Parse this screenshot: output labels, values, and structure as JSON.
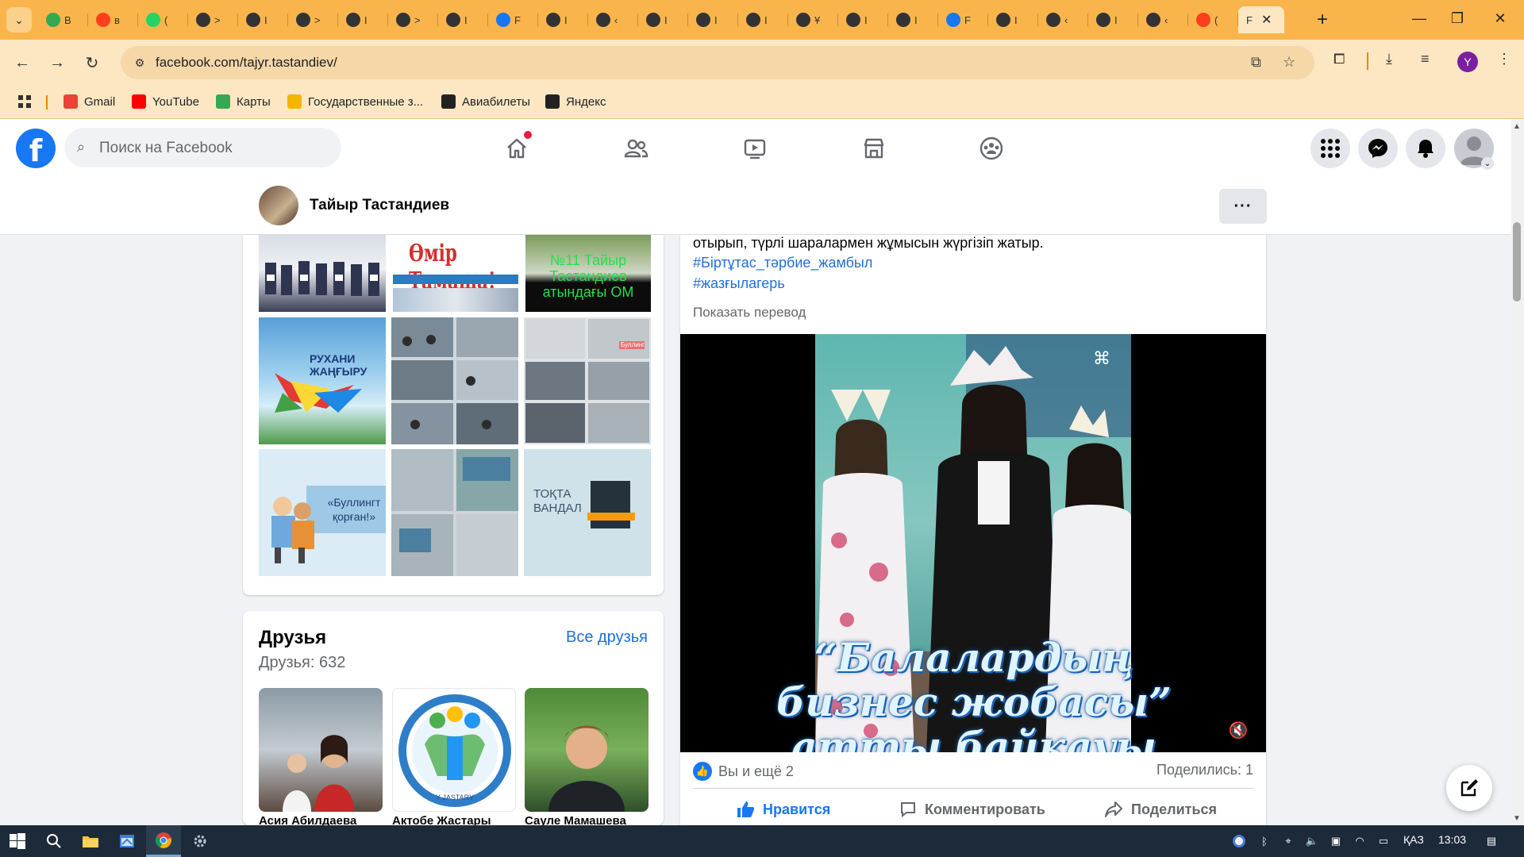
{
  "browser": {
    "tabs": [
      {
        "icon": "chat-green-icon",
        "color": "#34a853",
        "label": "В"
      },
      {
        "icon": "yandex-icon",
        "color": "#fc3f1d",
        "label": "в"
      },
      {
        "icon": "whatsapp-icon",
        "color": "#25d366",
        "label": "("
      },
      {
        "icon": "globe-icon",
        "color": "#333333",
        "label": ">"
      },
      {
        "icon": "globe-icon",
        "color": "#333333",
        "label": "І"
      },
      {
        "icon": "globe-icon",
        "color": "#333333",
        "label": ">"
      },
      {
        "icon": "globe-icon",
        "color": "#333333",
        "label": "І"
      },
      {
        "icon": "globe-icon",
        "color": "#333333",
        "label": ">"
      },
      {
        "icon": "globe-icon",
        "color": "#333333",
        "label": "І"
      },
      {
        "icon": "facebook-icon",
        "color": "#1877f2",
        "label": "F"
      },
      {
        "icon": "globe-icon",
        "color": "#333333",
        "label": "І"
      },
      {
        "icon": "globe-icon",
        "color": "#333333",
        "label": "‹"
      },
      {
        "icon": "globe-icon",
        "color": "#333333",
        "label": "І"
      },
      {
        "icon": "globe-icon",
        "color": "#333333",
        "label": "І"
      },
      {
        "icon": "globe-icon",
        "color": "#333333",
        "label": "І"
      },
      {
        "icon": "globe-icon",
        "color": "#333333",
        "label": "Ұ"
      },
      {
        "icon": "globe-icon",
        "color": "#333333",
        "label": "І"
      },
      {
        "icon": "globe-icon",
        "color": "#333333",
        "label": "І"
      },
      {
        "icon": "facebook-icon",
        "color": "#1877f2",
        "label": "F"
      },
      {
        "icon": "globe-icon",
        "color": "#333333",
        "label": "І"
      },
      {
        "icon": "globe-icon",
        "color": "#333333",
        "label": "‹"
      },
      {
        "icon": "globe-icon",
        "color": "#333333",
        "label": "І"
      },
      {
        "icon": "globe-icon",
        "color": "#333333",
        "label": "‹"
      },
      {
        "icon": "yandex-icon",
        "color": "#fc3f1d",
        "label": "("
      }
    ],
    "active_tab_label": "F",
    "url": "facebook.com/tajyr.tastandiev/",
    "bookmarks": [
      {
        "label": "Gmail",
        "icon": "gmail-icon",
        "color": "#ea4335"
      },
      {
        "label": "YouTube",
        "icon": "youtube-icon",
        "color": "#ff0000"
      },
      {
        "label": "Карты",
        "icon": "maps-icon",
        "color": "#34a853"
      },
      {
        "label": "Государственные з...",
        "icon": "gov-icon",
        "color": "#f4b400"
      },
      {
        "label": "Авиабилеты",
        "icon": "globe-icon",
        "color": "#222222"
      },
      {
        "label": "Яндекс",
        "icon": "globe-icon",
        "color": "#222222"
      }
    ]
  },
  "facebook": {
    "search_placeholder": "Поиск на Facebook",
    "profile_name": "Тайыр Тастандиев",
    "post": {
      "text_line": "отырып, түрлі шаралармен жұмысын жүргізіп жатыр.",
      "hashtags": [
        "#Біртұтас_тәрбие_жамбыл",
        "#жазғылагерь"
      ],
      "translate": "Показать перевод",
      "video_title": "“Балалардың бизнес жобасы” атты байқауы",
      "reactions": "Вы и ещё 2",
      "shares": "Поделились: 1",
      "actions": {
        "like": "Нравится",
        "comment": "Комментировать",
        "share": "Поделиться"
      }
    },
    "photos": [
      {
        "caption": ""
      },
      {
        "caption": "Өмір Тамаша!"
      },
      {
        "caption": "№11 Тайыр Тастандиев атындағы ОМ"
      },
      {
        "caption": "РУХАНИ ЖАҢҒЫРУ"
      },
      {
        "caption": ""
      },
      {
        "caption": "Буллинг"
      },
      {
        "caption": "«Буллингт қорған!»"
      },
      {
        "caption": ""
      },
      {
        "caption": "ТОҚТА ВАНДАЛ"
      }
    ],
    "friends": {
      "title": "Друзья",
      "all_label": "Все друзья",
      "count_label": "Друзья: 632",
      "items": [
        {
          "name": "Асия Абилдаева"
        },
        {
          "name": "Актобе Жастары"
        },
        {
          "name": "Сауле Мамашева"
        }
      ]
    }
  },
  "taskbar": {
    "lang": "ҚАЗ",
    "time": "13:03"
  }
}
